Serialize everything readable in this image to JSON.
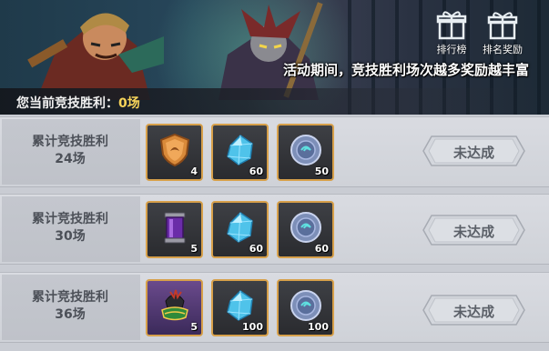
{
  "header": {
    "slogan": "活动期间，竞技胜利场次越多奖励越丰富",
    "ranking_label": "排行榜",
    "rank_reward_label": "排名奖励"
  },
  "status": {
    "label": "您当前竞技胜利：",
    "value": "0场"
  },
  "tiers": [
    {
      "title_line1": "累计竞技胜利",
      "title_line2": "24场",
      "button": "未达成",
      "rewards": [
        {
          "icon": "bronze-shield-medal",
          "count": "4"
        },
        {
          "icon": "blue-diamond",
          "count": "60"
        },
        {
          "icon": "silver-coin",
          "count": "50"
        }
      ]
    },
    {
      "title_line1": "累计竞技胜利",
      "title_line2": "30场",
      "button": "未达成",
      "rewards": [
        {
          "icon": "purple-scroll",
          "count": "5"
        },
        {
          "icon": "blue-diamond",
          "count": "60"
        },
        {
          "icon": "silver-coin",
          "count": "60"
        }
      ]
    },
    {
      "title_line1": "累计竞技胜利",
      "title_line2": "36场",
      "button": "未达成",
      "rewards": [
        {
          "icon": "warrior-helmet",
          "count": "5"
        },
        {
          "icon": "blue-diamond",
          "count": "100"
        },
        {
          "icon": "silver-coin",
          "count": "100"
        }
      ]
    }
  ],
  "colors": {
    "slot_border": "#d7a04a",
    "highlight_value": "#f6d35a",
    "button_text": "#5b6068"
  }
}
